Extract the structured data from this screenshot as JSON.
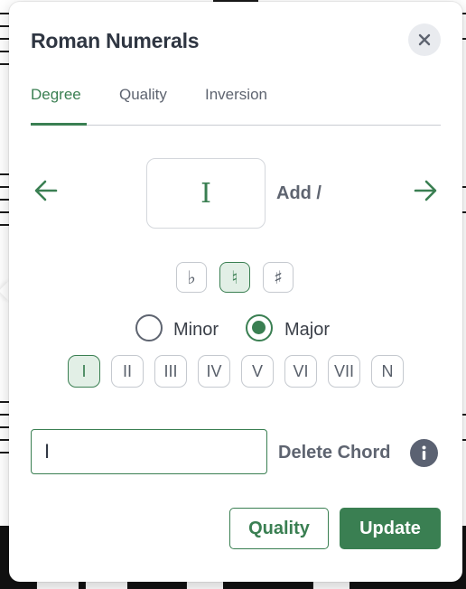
{
  "dialog": {
    "title": "Roman Numerals",
    "close_icon": "close-icon"
  },
  "tabs": [
    {
      "label": "Degree",
      "active": true
    },
    {
      "label": "Quality",
      "active": false
    },
    {
      "label": "Inversion",
      "active": false
    }
  ],
  "degree_editor": {
    "prev_icon": "arrow-left-icon",
    "next_icon": "arrow-right-icon",
    "current_numeral": "I",
    "add_slash_label": "Add /"
  },
  "accidentals": [
    {
      "symbol": "♭",
      "name": "flat",
      "selected": false
    },
    {
      "symbol": "♮",
      "name": "natural",
      "selected": true
    },
    {
      "symbol": "♯",
      "name": "sharp",
      "selected": false
    }
  ],
  "mode": {
    "options": [
      {
        "label": "Minor",
        "checked": false
      },
      {
        "label": "Major",
        "checked": true
      }
    ]
  },
  "degrees": [
    {
      "label": "I",
      "selected": true
    },
    {
      "label": "II",
      "selected": false
    },
    {
      "label": "III",
      "selected": false
    },
    {
      "label": "IV",
      "selected": false
    },
    {
      "label": "V",
      "selected": false
    },
    {
      "label": "VI",
      "selected": false
    },
    {
      "label": "VII",
      "selected": false
    },
    {
      "label": "N",
      "selected": false
    }
  ],
  "chord_input": {
    "value": "I"
  },
  "actions": {
    "delete_chord_label": "Delete Chord",
    "info_icon": "info-icon",
    "quality_label": "Quality",
    "update_label": "Update"
  },
  "colors": {
    "accent": "#3a7f52",
    "accent_light": "#e2efe6",
    "text_dark": "#2f3642",
    "text_muted": "#5e6470"
  }
}
